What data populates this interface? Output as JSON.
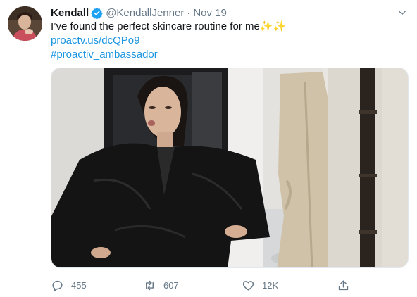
{
  "tweet": {
    "author_name": "Kendall",
    "handle": "@KendallJenner",
    "separator": "·",
    "date": "Nov 19",
    "text": "I’ve found the perfect skincare routine for me",
    "emoji": "✨✨",
    "link": "proactv.us/dcQPo9",
    "hashtag": "#proactiv_ambassador"
  },
  "actions": {
    "replies": "455",
    "retweets": "607",
    "likes": "12K"
  },
  "icons": {
    "verified": "verified-badge-icon",
    "caret": "chevron-down-icon",
    "reply": "reply-icon",
    "retweet": "retweet-icon",
    "like": "heart-icon",
    "share": "share-icon"
  },
  "colors": {
    "link": "#1b95e0",
    "muted": "#657786",
    "verified": "#1da1f2",
    "text": "#14171a"
  }
}
